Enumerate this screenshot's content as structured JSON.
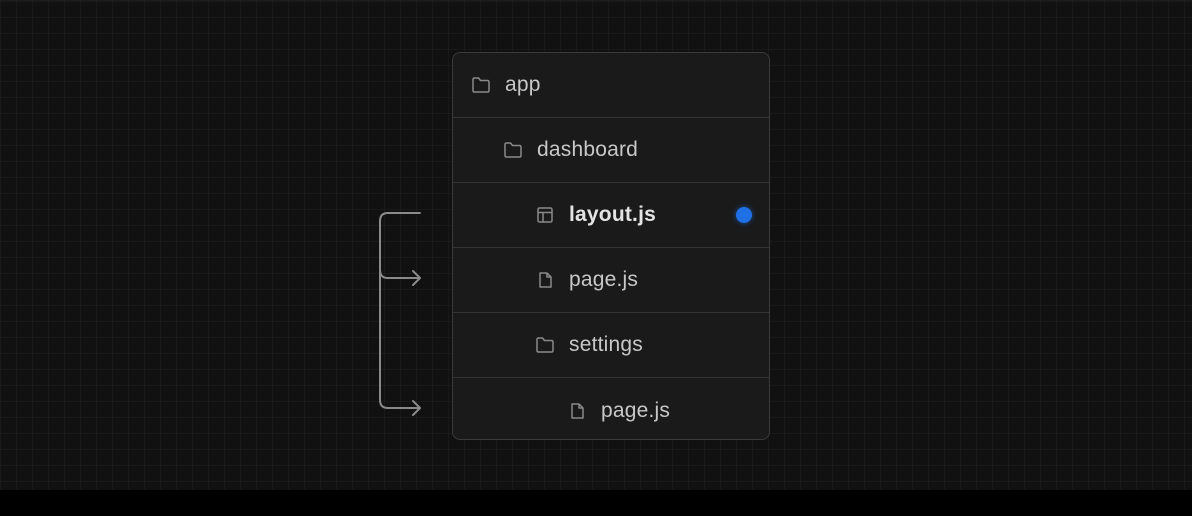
{
  "tree": {
    "rows": [
      {
        "label": "app",
        "icon": "folder-icon",
        "depth": 0
      },
      {
        "label": "dashboard",
        "icon": "folder-icon",
        "depth": 1
      },
      {
        "label": "layout.js",
        "icon": "layout-icon",
        "depth": 2,
        "highlighted": true
      },
      {
        "label": "page.js",
        "icon": "file-icon",
        "depth": 2
      },
      {
        "label": "settings",
        "icon": "folder-icon",
        "depth": 2
      },
      {
        "label": "page.js",
        "icon": "file-icon",
        "depth": 3
      }
    ]
  },
  "colors": {
    "background": "#111111",
    "panel": "#1a1a1a",
    "border": "#3a3a3a",
    "text": "#c8c8c8",
    "accent_dot": "#1f6fe5",
    "connector": "#8a8a8a"
  }
}
